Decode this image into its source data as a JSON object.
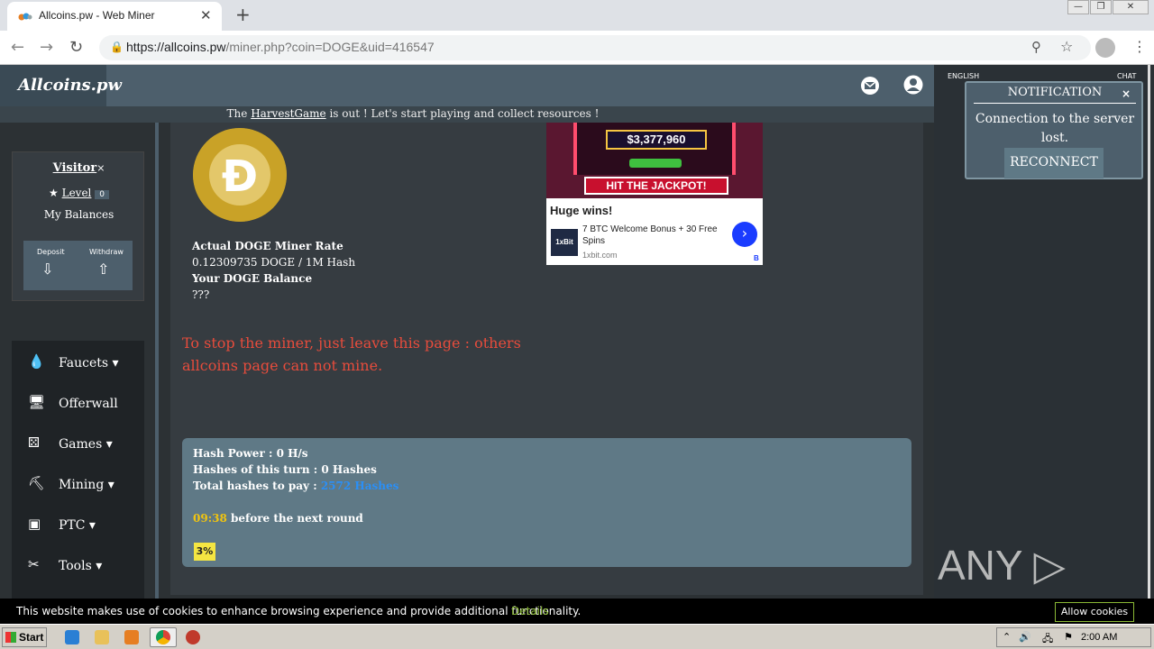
{
  "browser": {
    "tab_title": "Allcoins.pw - Web Miner",
    "tab_close": "✕",
    "new_tab": "+",
    "url_host": "https://allcoins.pw",
    "url_path": "/miner.php?coin=DOGE&uid=416547",
    "window_min": "—",
    "window_restore": "❐",
    "window_close": "✕"
  },
  "header": {
    "logo": "Allcoins.pw"
  },
  "announcement": {
    "prefix": "The ",
    "link": "HarvestGame",
    "suffix": " is out ! Let's start playing and collect resources !"
  },
  "visitor": {
    "name": "Visitor",
    "close": "×",
    "level_label": "Level",
    "level_value": "0",
    "balances": "My Balances",
    "deposit": "Deposit",
    "withdraw": "Withdraw"
  },
  "menu": [
    {
      "label": "Faucets",
      "icon": "drop-icon"
    },
    {
      "label": "Offerwall",
      "icon": "monitor-icon"
    },
    {
      "label": "Games",
      "icon": "dice-icon"
    },
    {
      "label": "Mining",
      "icon": "camera-icon"
    },
    {
      "label": "PTC",
      "icon": "window-icon"
    },
    {
      "label": "Tools",
      "icon": "wrench-icon"
    }
  ],
  "miner": {
    "rate_title": "Actual DOGE Miner Rate",
    "rate_value": "0.12309735 DOGE / 1M Hash",
    "balance_title": "Your DOGE Balance",
    "balance_value": "???",
    "warning": "To stop the miner, just leave this page : others allcoins page can not mine."
  },
  "ad": {
    "amount": "$3,377,960",
    "jackpot": "HIT THE JACKPOT!",
    "headline": "Huge wins!",
    "brand": "1xBit",
    "text": "7 BTC Welcome Bonus + 30 Free Spins",
    "site": "1xbit.com",
    "badge": "B"
  },
  "hash": {
    "power_label": "Hash Power : ",
    "power_value": "0 H/s",
    "turn_label": "Hashes of this turn : ",
    "turn_value": "0 Hashes",
    "total_label": "Total hashes to pay : ",
    "total_value": "2572 Hashes",
    "timer": "09:38",
    "timer_suffix": " before the next round",
    "progress_text": "3%",
    "progress": 0.03
  },
  "right_panel": {
    "tab_english": "ENGLISH",
    "tab_chat": "CHAT"
  },
  "notification": {
    "title": "NOTIFICATION",
    "close": "×",
    "message": "Connection to the server lost.",
    "button": "RECONNECT"
  },
  "watermark": "ANY ▷ RUN",
  "cookie": {
    "message": "This website makes use of cookies to enhance browsing experience and provide additional functionality.",
    "details": "Details",
    "allow": "Allow cookies"
  },
  "taskbar": {
    "start": "Start",
    "clock": "2:00 AM"
  },
  "colors": {
    "header": "#4d5f6c",
    "warning": "#e74c3c",
    "hash_panel": "#5f7986",
    "timer": "#f1c40f",
    "link_blue": "#2a8ff7"
  }
}
